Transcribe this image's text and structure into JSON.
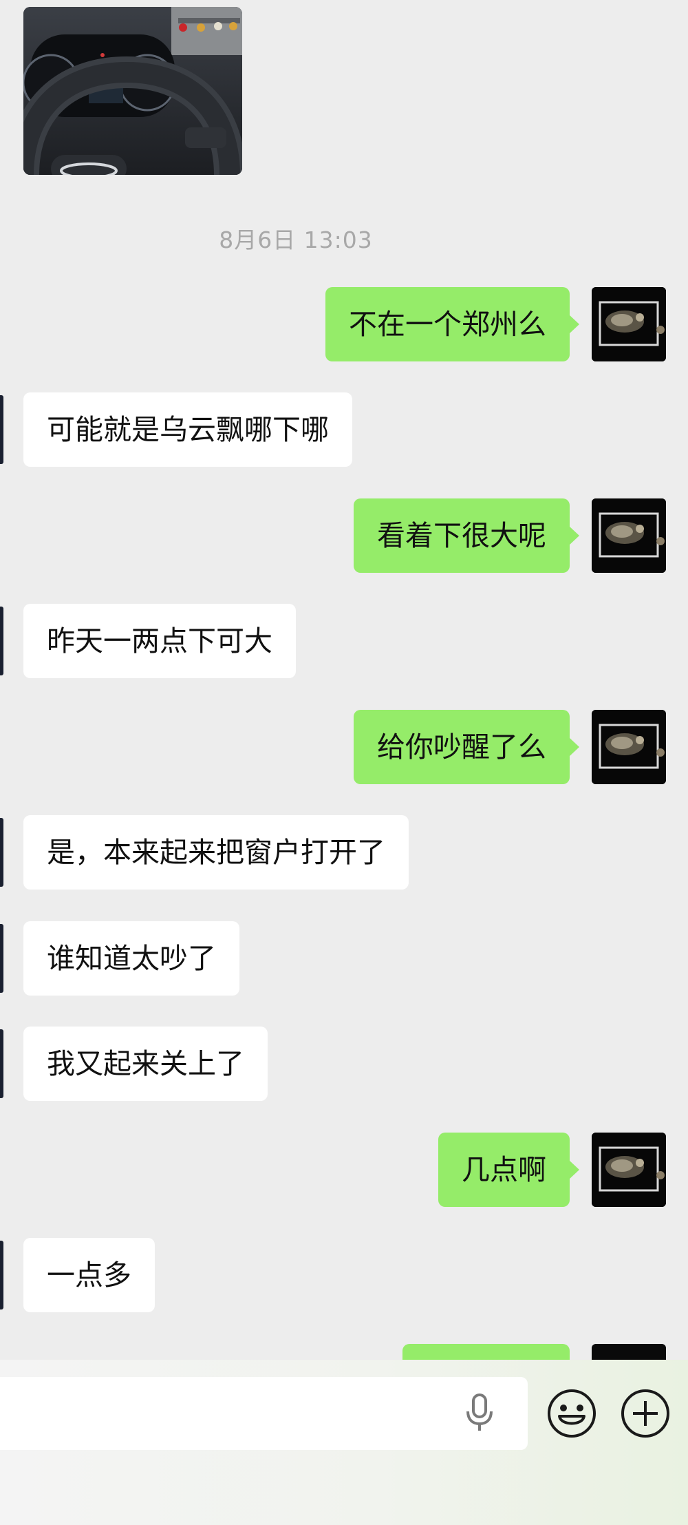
{
  "chat": {
    "timestamp": "8月6日 13:03",
    "messages": [
      {
        "dir": "out",
        "text": "不在一个郑州么"
      },
      {
        "dir": "in",
        "text": "可能就是乌云飘哪下哪"
      },
      {
        "dir": "out",
        "text": "看着下很大呢"
      },
      {
        "dir": "in",
        "text": "昨天一两点下可大"
      },
      {
        "dir": "out",
        "text": "给你吵醒了么"
      },
      {
        "dir": "in",
        "text": "是，本来起来把窗户打开了"
      },
      {
        "dir": "in",
        "text": "谁知道太吵了"
      },
      {
        "dir": "in",
        "text": "我又起来关上了"
      },
      {
        "dir": "out",
        "text": "几点啊"
      },
      {
        "dir": "in",
        "text": "一点多"
      }
    ]
  },
  "input_bar": {
    "icons": [
      "microphone-icon",
      "emoji-icon",
      "plus-icon"
    ]
  },
  "colors": {
    "background": "#ededed",
    "outgoing_bubble": "#95ec69",
    "incoming_bubble": "#ffffff",
    "timestamp_text": "#a8a8a8"
  }
}
